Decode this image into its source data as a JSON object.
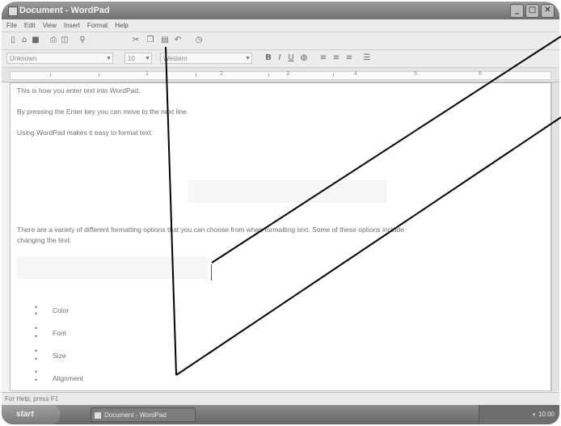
{
  "window": {
    "title": "Document - WordPad"
  },
  "menu": [
    "File",
    "Edit",
    "View",
    "Insert",
    "Format",
    "Help"
  ],
  "format": {
    "font": "Unknown",
    "size": "10",
    "script": "Western"
  },
  "document": {
    "paragraphs": [
      "This is how you enter text into WordPad.",
      "By pressing the Enter key you can move to the next line.",
      "Using WordPad makes it easy to format text.",
      "There are a variety of different formatting options that you can choose from when formatting text.  Some of these options include",
      "changing the text:"
    ],
    "list_items": [
      "Color",
      "Font",
      "Size",
      "Alignment"
    ]
  },
  "status": "For Help, press F1",
  "taskbar": {
    "start": "start",
    "task": "Document - WordPad",
    "clock": "10:00"
  },
  "icons": [
    "wordpad-icon",
    "minimize-icon",
    "maximize-icon",
    "close-icon",
    "new-icon",
    "open-icon",
    "save-icon",
    "print-icon",
    "print-preview-icon",
    "find-icon",
    "cut-icon",
    "copy-icon",
    "paste-icon",
    "undo-icon",
    "date-time-icon",
    "bold-icon",
    "italic-icon",
    "underline-icon",
    "color-icon",
    "align-left-icon",
    "align-center-icon",
    "align-right-icon",
    "bullets-icon",
    "bullet-icon",
    "start-logo-icon",
    "tray-icon"
  ]
}
